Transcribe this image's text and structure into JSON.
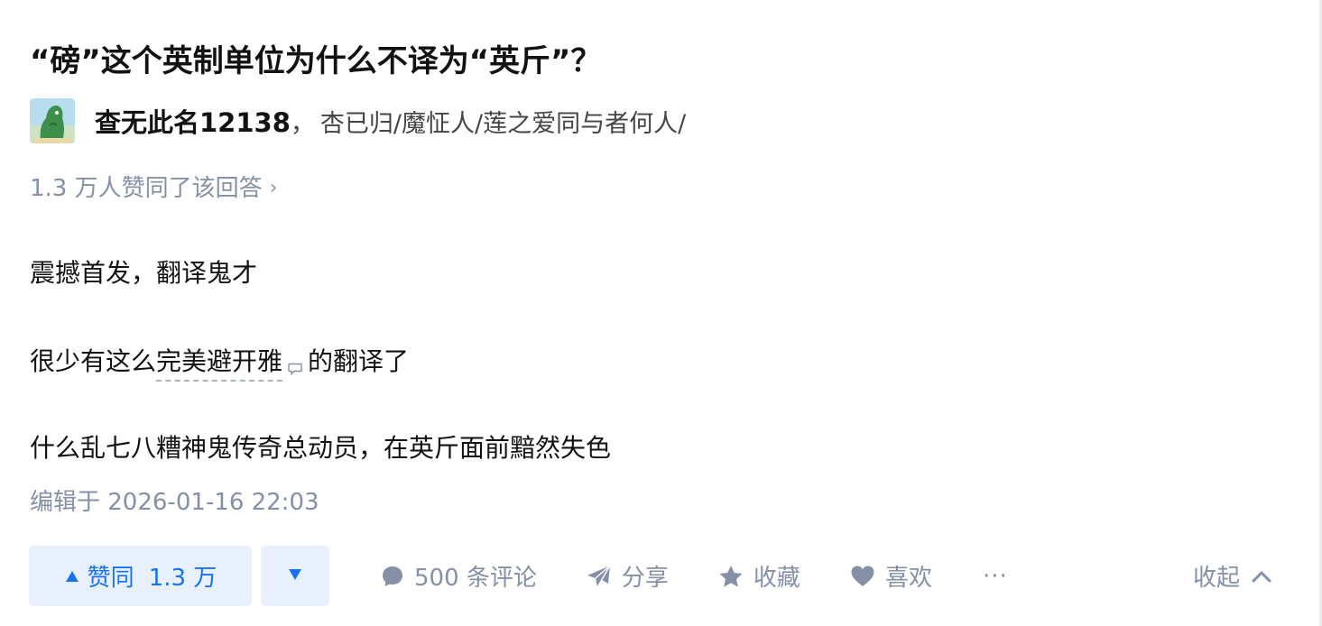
{
  "question": {
    "title": "“磅”这个英制单位为什么不译为“英斤”？"
  },
  "author": {
    "name": "查无此名12138",
    "separator": "，",
    "bio": "杏已归/魔怔人/莲之爱同与者何人/"
  },
  "upvote_summary": {
    "text": "1.3 万人赞同了该回答",
    "chevron": "›"
  },
  "answer": {
    "para1": "震撼首发，翻译鬼才",
    "para2_before": "很少有这么",
    "para2_link": "完美避开雅",
    "para2_after": "的翻译了",
    "para3": "什么乱七八糟神鬼传奇总动员，在英斤面前黯然失色"
  },
  "edited": "编辑于 2026-01-16 22:03",
  "actions": {
    "upvote_icon": "▲",
    "upvote_label": "赞同",
    "upvote_count": "1.3 万",
    "downvote_icon": "triangle-down-icon",
    "comments": "500 条评论",
    "share": "分享",
    "favorite": "收藏",
    "like": "喜欢",
    "more": "···",
    "collapse": "收起"
  },
  "colors": {
    "accent": "#1772f6",
    "accent_bg": "#e8f0fd",
    "muted": "#8590a6",
    "text": "#121212"
  }
}
